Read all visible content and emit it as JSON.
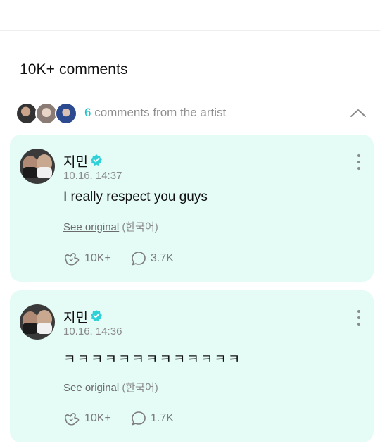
{
  "comments_header": {
    "count_label": "10K+ comments"
  },
  "artist_section": {
    "count": "6",
    "label_suffix": " comments from the artist",
    "avatars": [
      "avatar-1",
      "avatar-2",
      "avatar-3"
    ],
    "collapse_icon": "chevron-up-icon"
  },
  "colors": {
    "card_bg": "#e4fbf6",
    "accent": "#16c1c9",
    "verified": "#2fd1d9"
  },
  "comments": [
    {
      "author": "지민",
      "timestamp": "10.16. 14:37",
      "text": "I really respect you guys",
      "see_original": "See original",
      "language": "(한국어)",
      "likes": "10K+",
      "replies": "3.7K"
    },
    {
      "author": "지민",
      "timestamp": "10.16. 14:36",
      "text": "ㅋㅋㅋㅋㅋㅋㅋㅋㅋㅋㅋㅋㅋ",
      "see_original": "See original",
      "language": "(한국어)",
      "likes": "10K+",
      "replies": "1.7K"
    }
  ]
}
